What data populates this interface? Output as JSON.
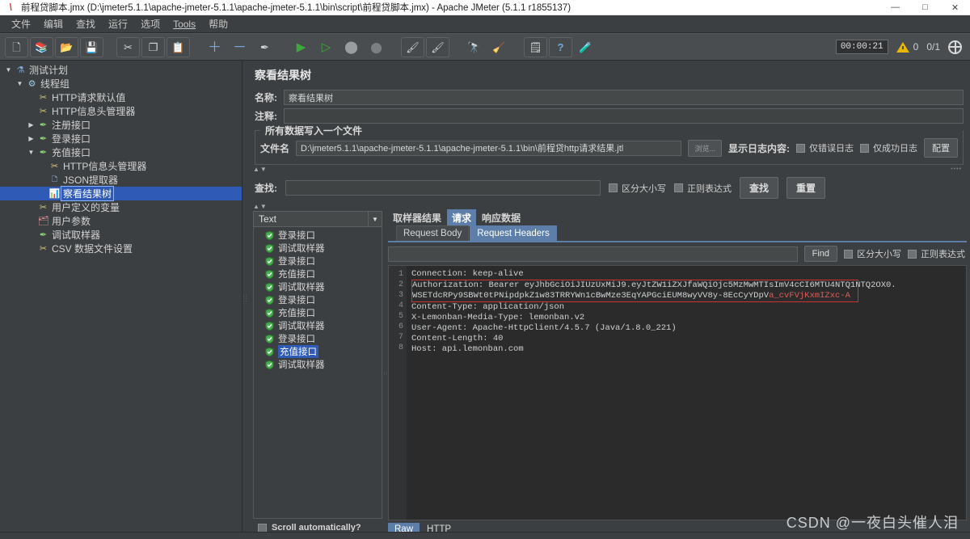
{
  "titlebar": {
    "icon": "jmeter-flame-icon",
    "title": "前程贷脚本.jmx (D:\\jmeter5.1.1\\apache-jmeter-5.1.1\\apache-jmeter-5.1.1\\bin\\script\\前程贷脚本.jmx) - Apache JMeter (5.1.1 r1855137)",
    "minimize": "—",
    "maximize": "□",
    "close": "✕"
  },
  "menubar": {
    "items": [
      {
        "label": "文件",
        "underlined": false
      },
      {
        "label": "编辑",
        "underlined": false
      },
      {
        "label": "查找",
        "underlined": false
      },
      {
        "label": "运行",
        "underlined": false
      },
      {
        "label": "选项",
        "underlined": false
      },
      {
        "label": "Tools",
        "underlined": true
      },
      {
        "label": "帮助",
        "underlined": false
      }
    ]
  },
  "toolbar": {
    "buttons": [
      {
        "name": "new-button",
        "glyph": "🗋"
      },
      {
        "name": "templates-button",
        "glyph": "📚"
      },
      {
        "name": "open-button",
        "glyph": "📂"
      },
      {
        "name": "save-button",
        "glyph": "💾"
      },
      {
        "name": "cut-button",
        "glyph": "✂"
      },
      {
        "name": "copy-button",
        "glyph": "❐"
      },
      {
        "name": "paste-button",
        "glyph": "📋"
      },
      {
        "name": "expand-all-button",
        "glyph": "＋"
      },
      {
        "name": "collapse-all-button",
        "glyph": "－"
      },
      {
        "name": "toggle-button",
        "glyph": "✒"
      },
      {
        "name": "start-button",
        "glyph": "▶"
      },
      {
        "name": "start-no-pauses-button",
        "glyph": "▷"
      },
      {
        "name": "stop-button",
        "glyph": "⬤"
      },
      {
        "name": "shutdown-button",
        "glyph": "⬤"
      },
      {
        "name": "remote-start-button",
        "glyph": "🖌"
      },
      {
        "name": "remote-stop-button",
        "glyph": "🖌"
      },
      {
        "name": "search-button",
        "glyph": "🔭"
      },
      {
        "name": "clear-button",
        "glyph": "🧹"
      },
      {
        "name": "clear-all-button",
        "glyph": "🗒"
      },
      {
        "name": "help-button",
        "glyph": "?"
      },
      {
        "name": "function-helper-button",
        "glyph": "🧪"
      }
    ],
    "timer": "00:00:21",
    "warn_count": "0",
    "thread_count": "0/1"
  },
  "tree": {
    "nodes": [
      {
        "label": "测试计划",
        "depth": 0,
        "expander": "▼",
        "icon": "test-plan-icon",
        "icon_glyph": "⚗",
        "icon_color": "#7aa8d8",
        "selected": false
      },
      {
        "label": "线程组",
        "depth": 1,
        "expander": "▼",
        "icon": "thread-group-icon",
        "icon_glyph": "⚙",
        "icon_color": "#9ecbe8",
        "selected": false
      },
      {
        "label": "HTTP请求默认值",
        "depth": 2,
        "expander": "",
        "icon": "config-element-icon",
        "icon_glyph": "✂",
        "icon_color": "#d8c87a",
        "selected": false
      },
      {
        "label": "HTTP信息头管理器",
        "depth": 2,
        "expander": "",
        "icon": "header-manager-icon",
        "icon_glyph": "✂",
        "icon_color": "#d8c87a",
        "selected": false
      },
      {
        "label": "注册接口",
        "depth": 2,
        "expander": "▶",
        "icon": "sampler-icon",
        "icon_glyph": "✒",
        "icon_color": "#8fd07a",
        "selected": false
      },
      {
        "label": "登录接口",
        "depth": 2,
        "expander": "▶",
        "icon": "sampler-icon",
        "icon_glyph": "✒",
        "icon_color": "#8fd07a",
        "selected": false
      },
      {
        "label": "充值接口",
        "depth": 2,
        "expander": "▼",
        "icon": "sampler-icon",
        "icon_glyph": "✒",
        "icon_color": "#8fd07a",
        "selected": false
      },
      {
        "label": "HTTP信息头管理器",
        "depth": 3,
        "expander": "",
        "icon": "header-manager-icon",
        "icon_glyph": "✂",
        "icon_color": "#d8c87a",
        "selected": false
      },
      {
        "label": "JSON提取器",
        "depth": 3,
        "expander": "",
        "icon": "post-processor-icon",
        "icon_glyph": "🗅",
        "icon_color": "#9fc4e8",
        "selected": false
      },
      {
        "label": "察看结果树",
        "depth": 3,
        "expander": "",
        "icon": "view-results-tree-icon",
        "icon_glyph": "📊",
        "icon_color": "#d79fd7",
        "selected": true
      },
      {
        "label": "用户定义的变量",
        "depth": 2,
        "expander": "",
        "icon": "config-element-icon",
        "icon_glyph": "✂",
        "icon_color": "#d8c87a",
        "selected": false
      },
      {
        "label": "用户参数",
        "depth": 2,
        "expander": "",
        "icon": "user-parameters-icon",
        "icon_glyph": "🗂",
        "icon_color": "#e09a9a",
        "selected": false
      },
      {
        "label": "调试取样器",
        "depth": 2,
        "expander": "",
        "icon": "sampler-icon",
        "icon_glyph": "✒",
        "icon_color": "#8fd07a",
        "selected": false
      },
      {
        "label": "CSV 数据文件设置",
        "depth": 2,
        "expander": "",
        "icon": "csv-data-set-icon",
        "icon_glyph": "✂",
        "icon_color": "#d8c87a",
        "selected": false
      }
    ]
  },
  "panel": {
    "title": "察看结果树",
    "name_label": "名称:",
    "name_value": "察看结果树",
    "comment_label": "注释:",
    "comment_value": "",
    "file_group_title": "所有数据写入一个文件",
    "filename_label": "文件名",
    "filename_value": "D:\\jmeter5.1.1\\apache-jmeter-5.1.1\\apache-jmeter-5.1.1\\bin\\前程贷http请求结果.jtl",
    "browse_button": "浏览...",
    "log_display_label": "显示日志内容:",
    "errors_only_label": "仅错误日志",
    "success_only_label": "仅成功日志",
    "configure_button": "配置"
  },
  "search": {
    "label": "查找:",
    "value": "",
    "case_sensitive_label": "区分大小写",
    "regex_label": "正则表达式",
    "search_button": "查找",
    "reset_button": "重置"
  },
  "results": {
    "renderer_selected": "Text",
    "scroll_label": "Scroll automatically?",
    "items": [
      {
        "label": "登录接口",
        "status": "success",
        "selected": false
      },
      {
        "label": "调试取样器",
        "status": "success",
        "selected": false
      },
      {
        "label": "登录接口",
        "status": "success",
        "selected": false
      },
      {
        "label": "充值接口",
        "status": "success",
        "selected": false
      },
      {
        "label": "调试取样器",
        "status": "success",
        "selected": false
      },
      {
        "label": "登录接口",
        "status": "success",
        "selected": false
      },
      {
        "label": "充值接口",
        "status": "success",
        "selected": false
      },
      {
        "label": "调试取样器",
        "status": "success",
        "selected": false
      },
      {
        "label": "登录接口",
        "status": "success",
        "selected": false
      },
      {
        "label": "充值接口",
        "status": "success",
        "selected": true
      },
      {
        "label": "调试取样器",
        "status": "success",
        "selected": false
      }
    ]
  },
  "detail": {
    "tabs": [
      {
        "label": "取样器结果",
        "active": false
      },
      {
        "label": "请求",
        "active": true
      },
      {
        "label": "响应数据",
        "active": false
      }
    ],
    "subtabs": [
      {
        "label": "Request Body",
        "active": false
      },
      {
        "label": "Request Headers",
        "active": true
      }
    ],
    "find": {
      "value": "",
      "button": "Find",
      "case_sensitive_label": "区分大小写",
      "regex_label": "正则表达式"
    },
    "bottom_tabs": [
      {
        "label": "Raw",
        "active": true
      },
      {
        "label": "HTTP",
        "active": false
      }
    ],
    "code": {
      "line_numbers": [
        "1",
        "2",
        "3",
        "4",
        "5",
        "6",
        "7",
        "8"
      ],
      "lines": [
        {
          "text": "Connection: keep-alive",
          "highlight": false
        },
        {
          "text": "Authorization: Bearer eyJhbGciOiJIUzUxMiJ9.eyJtZW1iZXJfaWQiOjc5MzMwMTIsImV4cCI6MTU4NTQ1NTQ2OX0.",
          "highlight": true
        },
        {
          "text": "WSETdcRPy9SBWt0tPNipdpkZ1w83TRRYWn1cBwMze3EqYAPGciEUM8wyVV8y-8EcCyYDpVa_cvFVjKxmIZxc-A",
          "highlight": true,
          "continuation": true,
          "red_from": 70
        },
        {
          "text": "Content-Type: application/json",
          "highlight": false
        },
        {
          "text": "X-Lemonban-Media-Type: lemonban.v2",
          "highlight": false
        },
        {
          "text": "User-Agent: Apache-HttpClient/4.5.7 (Java/1.8.0_221)",
          "highlight": false
        },
        {
          "text": "Content-Length: 40",
          "highlight": false
        },
        {
          "text": "Host: api.lemonban.com",
          "highlight": false
        }
      ]
    }
  },
  "watermark": "CSDN @一夜白头催人泪",
  "colors": {
    "window_bg": "#3c3f41",
    "selection_blue": "#2f5bb7",
    "tab_active": "#5c7ea8",
    "code_bg": "#2b2b2b",
    "highlight_border": "#cc3333",
    "success_green": "#4caf50",
    "warn_yellow": "#e8b800"
  }
}
